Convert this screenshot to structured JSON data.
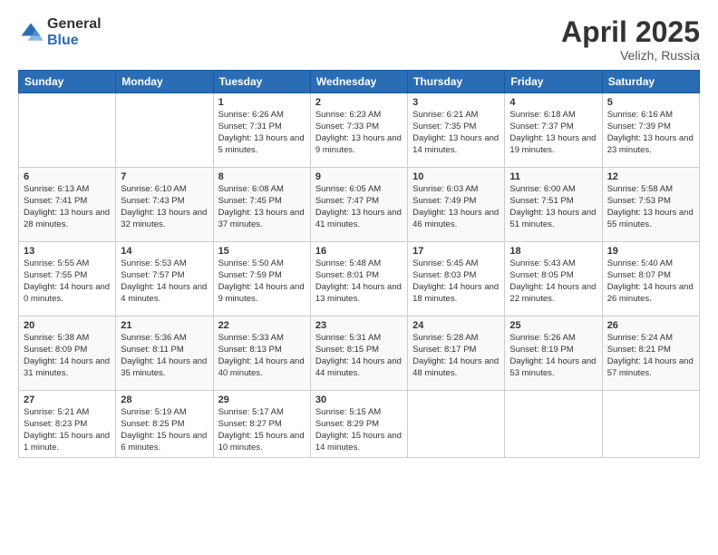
{
  "logo": {
    "general": "General",
    "blue": "Blue"
  },
  "title": {
    "month_year": "April 2025",
    "location": "Velizh, Russia"
  },
  "weekdays": [
    "Sunday",
    "Monday",
    "Tuesday",
    "Wednesday",
    "Thursday",
    "Friday",
    "Saturday"
  ],
  "weeks": [
    [
      {
        "day": "",
        "info": ""
      },
      {
        "day": "",
        "info": ""
      },
      {
        "day": "1",
        "info": "Sunrise: 6:26 AM\nSunset: 7:31 PM\nDaylight: 13 hours and 5 minutes."
      },
      {
        "day": "2",
        "info": "Sunrise: 6:23 AM\nSunset: 7:33 PM\nDaylight: 13 hours and 9 minutes."
      },
      {
        "day": "3",
        "info": "Sunrise: 6:21 AM\nSunset: 7:35 PM\nDaylight: 13 hours and 14 minutes."
      },
      {
        "day": "4",
        "info": "Sunrise: 6:18 AM\nSunset: 7:37 PM\nDaylight: 13 hours and 19 minutes."
      },
      {
        "day": "5",
        "info": "Sunrise: 6:16 AM\nSunset: 7:39 PM\nDaylight: 13 hours and 23 minutes."
      }
    ],
    [
      {
        "day": "6",
        "info": "Sunrise: 6:13 AM\nSunset: 7:41 PM\nDaylight: 13 hours and 28 minutes."
      },
      {
        "day": "7",
        "info": "Sunrise: 6:10 AM\nSunset: 7:43 PM\nDaylight: 13 hours and 32 minutes."
      },
      {
        "day": "8",
        "info": "Sunrise: 6:08 AM\nSunset: 7:45 PM\nDaylight: 13 hours and 37 minutes."
      },
      {
        "day": "9",
        "info": "Sunrise: 6:05 AM\nSunset: 7:47 PM\nDaylight: 13 hours and 41 minutes."
      },
      {
        "day": "10",
        "info": "Sunrise: 6:03 AM\nSunset: 7:49 PM\nDaylight: 13 hours and 46 minutes."
      },
      {
        "day": "11",
        "info": "Sunrise: 6:00 AM\nSunset: 7:51 PM\nDaylight: 13 hours and 51 minutes."
      },
      {
        "day": "12",
        "info": "Sunrise: 5:58 AM\nSunset: 7:53 PM\nDaylight: 13 hours and 55 minutes."
      }
    ],
    [
      {
        "day": "13",
        "info": "Sunrise: 5:55 AM\nSunset: 7:55 PM\nDaylight: 14 hours and 0 minutes."
      },
      {
        "day": "14",
        "info": "Sunrise: 5:53 AM\nSunset: 7:57 PM\nDaylight: 14 hours and 4 minutes."
      },
      {
        "day": "15",
        "info": "Sunrise: 5:50 AM\nSunset: 7:59 PM\nDaylight: 14 hours and 9 minutes."
      },
      {
        "day": "16",
        "info": "Sunrise: 5:48 AM\nSunset: 8:01 PM\nDaylight: 14 hours and 13 minutes."
      },
      {
        "day": "17",
        "info": "Sunrise: 5:45 AM\nSunset: 8:03 PM\nDaylight: 14 hours and 18 minutes."
      },
      {
        "day": "18",
        "info": "Sunrise: 5:43 AM\nSunset: 8:05 PM\nDaylight: 14 hours and 22 minutes."
      },
      {
        "day": "19",
        "info": "Sunrise: 5:40 AM\nSunset: 8:07 PM\nDaylight: 14 hours and 26 minutes."
      }
    ],
    [
      {
        "day": "20",
        "info": "Sunrise: 5:38 AM\nSunset: 8:09 PM\nDaylight: 14 hours and 31 minutes."
      },
      {
        "day": "21",
        "info": "Sunrise: 5:36 AM\nSunset: 8:11 PM\nDaylight: 14 hours and 35 minutes."
      },
      {
        "day": "22",
        "info": "Sunrise: 5:33 AM\nSunset: 8:13 PM\nDaylight: 14 hours and 40 minutes."
      },
      {
        "day": "23",
        "info": "Sunrise: 5:31 AM\nSunset: 8:15 PM\nDaylight: 14 hours and 44 minutes."
      },
      {
        "day": "24",
        "info": "Sunrise: 5:28 AM\nSunset: 8:17 PM\nDaylight: 14 hours and 48 minutes."
      },
      {
        "day": "25",
        "info": "Sunrise: 5:26 AM\nSunset: 8:19 PM\nDaylight: 14 hours and 53 minutes."
      },
      {
        "day": "26",
        "info": "Sunrise: 5:24 AM\nSunset: 8:21 PM\nDaylight: 14 hours and 57 minutes."
      }
    ],
    [
      {
        "day": "27",
        "info": "Sunrise: 5:21 AM\nSunset: 8:23 PM\nDaylight: 15 hours and 1 minute."
      },
      {
        "day": "28",
        "info": "Sunrise: 5:19 AM\nSunset: 8:25 PM\nDaylight: 15 hours and 6 minutes."
      },
      {
        "day": "29",
        "info": "Sunrise: 5:17 AM\nSunset: 8:27 PM\nDaylight: 15 hours and 10 minutes."
      },
      {
        "day": "30",
        "info": "Sunrise: 5:15 AM\nSunset: 8:29 PM\nDaylight: 15 hours and 14 minutes."
      },
      {
        "day": "",
        "info": ""
      },
      {
        "day": "",
        "info": ""
      },
      {
        "day": "",
        "info": ""
      }
    ]
  ]
}
